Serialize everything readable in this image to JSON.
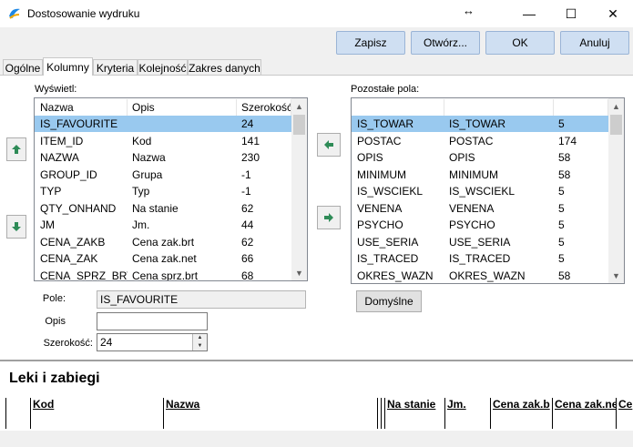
{
  "window": {
    "title": "Dostosowanie wydruku",
    "minimize": "—",
    "maximize": "☐",
    "close": "✕",
    "resize_glyph": "↔"
  },
  "toolbar": {
    "print": "Zapisz",
    "open": "Otwórz...",
    "ok": "OK",
    "cancel": "Anuluj"
  },
  "tabs": [
    {
      "label": "Ogólne"
    },
    {
      "label": "Kolumny"
    },
    {
      "label": "Kryteria"
    },
    {
      "label": "Kolejność"
    },
    {
      "label": "Zakres danych"
    }
  ],
  "left": {
    "label": "Wyświetl:",
    "headers": [
      "Nazwa",
      "Opis",
      "Szerokość"
    ],
    "rows": [
      [
        "IS_FAVOURITE",
        "",
        "24"
      ],
      [
        "ITEM_ID",
        "Kod",
        "141"
      ],
      [
        "NAZWA",
        "Nazwa",
        "230"
      ],
      [
        "GROUP_ID",
        "Grupa",
        "-1"
      ],
      [
        "TYP",
        "Typ",
        "-1"
      ],
      [
        "QTY_ONHAND",
        "Na stanie",
        "62"
      ],
      [
        "JM",
        "Jm.",
        "44"
      ],
      [
        "CENA_ZAKB",
        "Cena zak.brt",
        "62"
      ],
      [
        "CENA_ZAK",
        "Cena zak.net",
        "66"
      ],
      [
        "CENA_SPRZ_BRT",
        "Cena sprz.brt",
        "68"
      ]
    ]
  },
  "right": {
    "label": "Pozostałe pola:",
    "rows": [
      [
        "IS_TOWAR",
        "IS_TOWAR",
        "5"
      ],
      [
        "POSTAC",
        "POSTAC",
        "174"
      ],
      [
        "OPIS",
        "OPIS",
        "58"
      ],
      [
        "MINIMUM",
        "MINIMUM",
        "58"
      ],
      [
        "IS_WSCIEKL",
        "IS_WSCIEKL",
        "5"
      ],
      [
        "VENENA",
        "VENENA",
        "5"
      ],
      [
        "PSYCHO",
        "PSYCHO",
        "5"
      ],
      [
        "USE_SERIA",
        "USE_SERIA",
        "5"
      ],
      [
        "IS_TRACED",
        "IS_TRACED",
        "5"
      ],
      [
        "OKRES_WAZN",
        "OKRES_WAZN",
        "58"
      ]
    ]
  },
  "form": {
    "pole_label": "Pole:",
    "pole_value": "IS_FAVOURITE",
    "opis_label": "Opis",
    "opis_value": "",
    "szer_label": "Szerokość:",
    "szer_value": "24",
    "default_button": "Domyślne"
  },
  "preview": {
    "title": "Leki i zabiegi",
    "columns": [
      "Kod",
      "Nazwa",
      "Na stanie",
      "Jm.",
      "Cena zak.b",
      "Cena zak.ne",
      "Ce"
    ]
  },
  "colors": {
    "selection": "#99c9ef",
    "accent_button": "#cfdff2",
    "arrow_green": "#2e8b57"
  }
}
